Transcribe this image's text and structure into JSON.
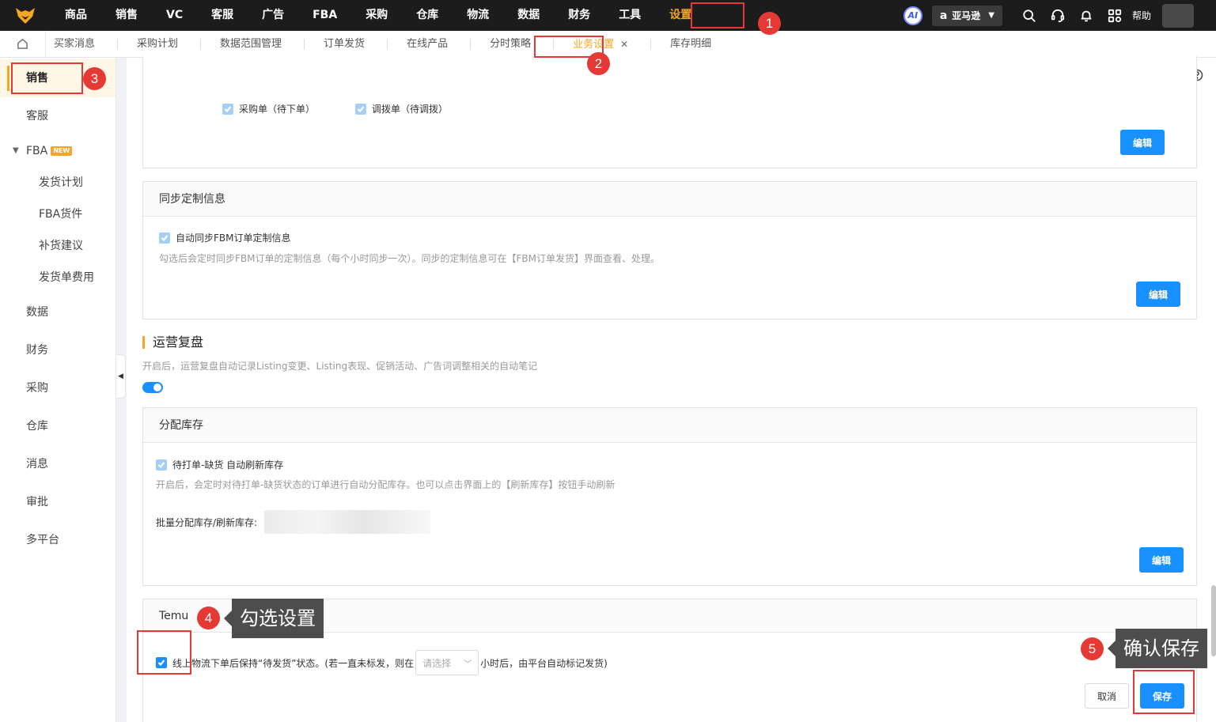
{
  "topnav": {
    "items": [
      "商品",
      "销售",
      "VC",
      "客服",
      "广告",
      "FBA",
      "采购",
      "仓库",
      "物流",
      "数据",
      "财务",
      "工具",
      "设置"
    ],
    "active": "设置",
    "ai_label": "AI",
    "platform": "亚马逊",
    "platform_glyph": "a",
    "help": "帮助"
  },
  "tabs": {
    "items": [
      "买家消息",
      "采购计划",
      "数据范围管理",
      "订单发货",
      "在线产品",
      "分时策略",
      "业务设置",
      "库存明细"
    ],
    "active": "业务设置",
    "close_glyph": "✕"
  },
  "sidebar": {
    "items": [
      {
        "label": "销售",
        "type": "item",
        "active": true
      },
      {
        "label": "客服",
        "type": "item"
      },
      {
        "label": "FBA",
        "type": "group",
        "badge": "NEW"
      },
      {
        "label": "发货计划",
        "type": "sub"
      },
      {
        "label": "FBA货件",
        "type": "sub"
      },
      {
        "label": "补货建议",
        "type": "sub"
      },
      {
        "label": "发货单费用",
        "type": "sub"
      },
      {
        "label": "数据",
        "type": "item"
      },
      {
        "label": "财务",
        "type": "item"
      },
      {
        "label": "采购",
        "type": "item"
      },
      {
        "label": "仓库",
        "type": "item"
      },
      {
        "label": "消息",
        "type": "item"
      },
      {
        "label": "审批",
        "type": "item"
      },
      {
        "label": "多平台",
        "type": "item"
      }
    ]
  },
  "main": {
    "card1": {
      "chk1": "采购单（待下单）",
      "chk2": "调拨单（待调拨）",
      "edit": "编辑"
    },
    "sync": {
      "title": "同步定制信息",
      "chk": "自动同步FBM订单定制信息",
      "hint": "勾选后会定时同步FBM订单的定制信息（每个小时同步一次）。同步的定制信息可在【FBM订单发货】界面查看、处理。",
      "edit": "编辑"
    },
    "review": {
      "title": "运营复盘",
      "hint": "开启后，运营复盘自动记录Listing变更、Listing表现、促销活动、广告词调整相关的自动笔记",
      "enabled": true
    },
    "stock": {
      "title": "分配库存",
      "chk": "待打单-缺货 自动刷新库存",
      "hint": "开启后，会定时对待打单-缺货状态的订单进行自动分配库存。也可以点击界面上的【刷新库存】按钮手动刷新",
      "batch_label": "批量分配库存/刷新库存:",
      "edit": "编辑"
    },
    "temu": {
      "title": "Temu",
      "chk_prefix": "线上物流下单后保持“待发货”状态。(若一直未标发，则在",
      "select_placeholder": "请选择",
      "chk_suffix": "小时后，由平台自动标记发货)",
      "cancel": "取消",
      "save": "保存"
    }
  },
  "annotations": {
    "n1": "1",
    "n2": "2",
    "n3": "3",
    "n4": "4",
    "n5": "5",
    "callout4": "勾选设置",
    "callout5": "确认保存",
    "color": "#e53935"
  }
}
